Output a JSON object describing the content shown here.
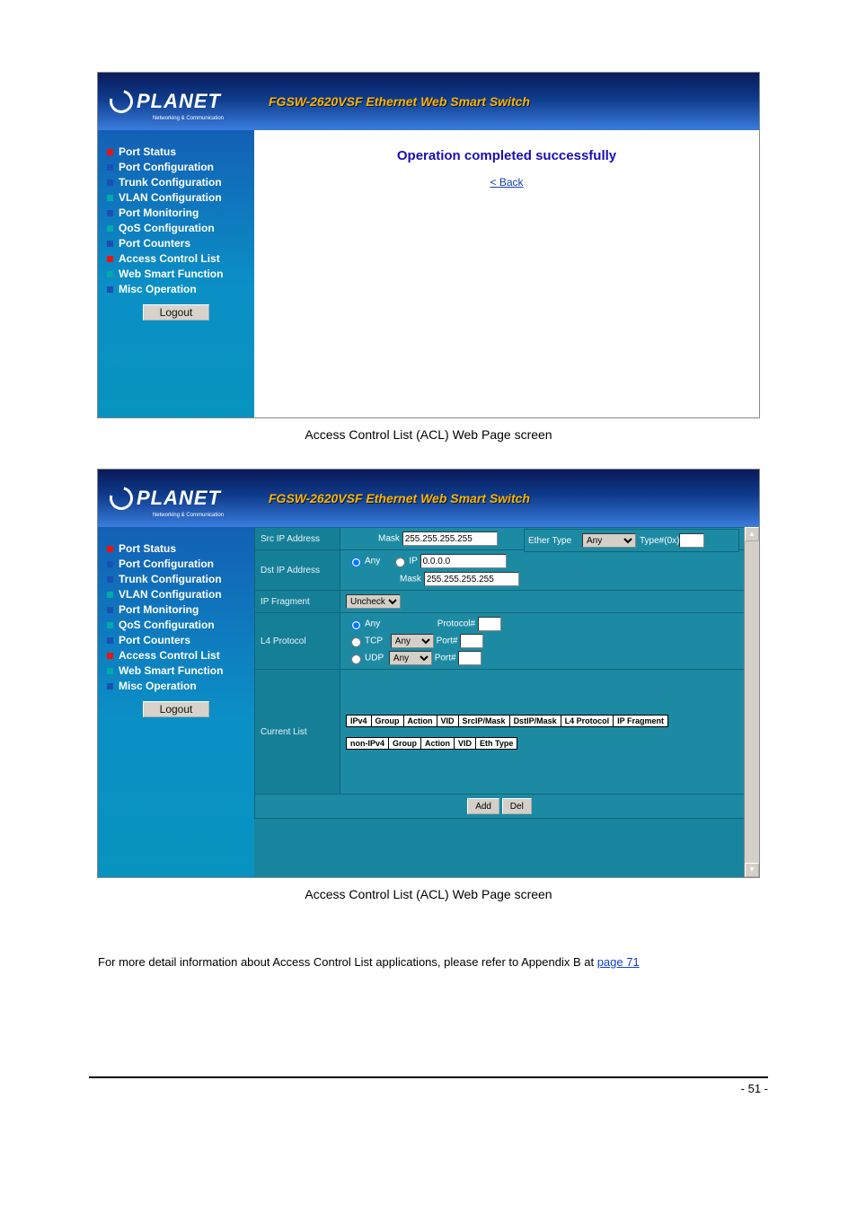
{
  "logo": {
    "brand": "PLANET",
    "sub": "Networking & Communication"
  },
  "banner_title": "FGSW-2620VSF Ethernet Web Smart Switch",
  "nav": [
    {
      "label": "Port Status",
      "sq": "red"
    },
    {
      "label": "Port Configuration",
      "sq": "blue"
    },
    {
      "label": "Trunk Configuration",
      "sq": "blue"
    },
    {
      "label": "VLAN Configuration",
      "sq": "cyan"
    },
    {
      "label": "Port Monitoring",
      "sq": "blue"
    },
    {
      "label": "QoS Configuration",
      "sq": "cyan"
    },
    {
      "label": "Port Counters",
      "sq": "blue"
    },
    {
      "label": "Access Control List",
      "sq": "red"
    },
    {
      "label": "Web Smart Function",
      "sq": "cyan"
    },
    {
      "label": "Misc Operation",
      "sq": "blue"
    }
  ],
  "logout": "Logout",
  "shot1": {
    "success_msg": "Operation completed successfully",
    "back_label": "< Back"
  },
  "caption1": "Access Control List (ACL) Web Page screen",
  "shot2": {
    "rows": {
      "src_ip": {
        "label": "Src IP Address",
        "mask_lbl": "Mask",
        "mask_val": "255.255.255.255"
      },
      "dst_ip": {
        "label": "Dst IP Address",
        "radio_any": "Any",
        "radio_ip": "IP",
        "ip_val": "0.0.0.0",
        "mask_lbl": "Mask",
        "mask_val": "255.255.255.255"
      },
      "ip_frag": {
        "label": "IP Fragment",
        "select_val": "Uncheck"
      },
      "l4": {
        "label": "L4 Protocol",
        "radio_any": "Any",
        "proto_lbl": "Protocol#",
        "tcp_lbl": "TCP",
        "tcp_sel": "Any",
        "tcp_port": "Port#",
        "udp_lbl": "UDP",
        "udp_sel": "Any",
        "udp_port": "Port#"
      },
      "current": {
        "label": "Current List",
        "header_ipv4": [
          "IPv4",
          "Group",
          "Action",
          "VID",
          "SrcIP/Mask",
          "DstIP/Mask",
          "L4 Protocol",
          "IP Fragment"
        ],
        "header_non": [
          "non-IPv4",
          "Group",
          "Action",
          "VID",
          "Eth Type"
        ]
      },
      "ether": {
        "label": "Ether Type",
        "sel": "Any",
        "typ_lbl": "Type#(0x)"
      }
    },
    "buttons": {
      "add": "Add",
      "del": "Del"
    }
  },
  "caption2": "Access Control List (ACL) Web Page screen",
  "paragraph": {
    "text": "For more detail information about Access Control List applications, please refer to Appendix B at ",
    "link": "page 71"
  },
  "page_number": "- 51 -"
}
